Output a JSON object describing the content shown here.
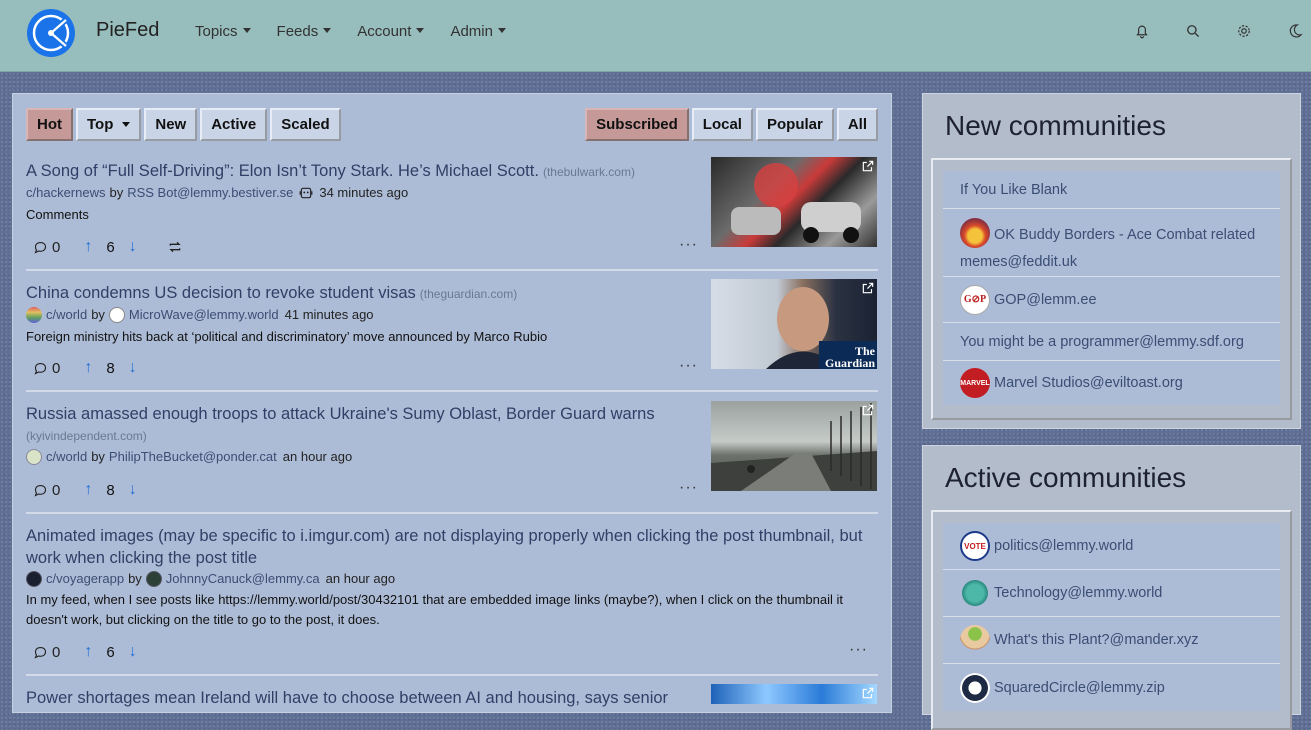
{
  "nav": {
    "brand": "PieFed",
    "menu": [
      "Topics",
      "Feeds",
      "Account",
      "Admin"
    ]
  },
  "sort": {
    "left": [
      "Hot",
      "Top",
      "New",
      "Active",
      "Scaled"
    ],
    "right": [
      "Subscribed",
      "Local",
      "Popular",
      "All"
    ]
  },
  "posts": [
    {
      "title": "A Song of “Full Self-Driving”: Elon Isn’t Tony Stark. He’s Michael Scott.",
      "domain": "thebulwark.com",
      "community": "c/hackernews",
      "by": "by",
      "user": "RSS Bot@lemmy.bestiver.se",
      "time": "34 minutes ago",
      "body": "Comments",
      "comments": "0",
      "score": "6"
    },
    {
      "title": "China condemns US decision to revoke student visas",
      "domain": "theguardian.com",
      "community": "c/world",
      "by": "by",
      "user": "MicroWave@lemmy.world",
      "time": "41 minutes ago",
      "body": "Foreign ministry hits back at ‘political and discriminatory’ move announced by Marco Rubio",
      "comments": "0",
      "score": "8",
      "thumb_text": "The Guardian"
    },
    {
      "title": "Russia amassed enough troops to attack Ukraine's Sumy Oblast, Border Guard warns",
      "domain": "kyivindependent.com",
      "community": "c/world",
      "by": "by",
      "user": "PhilipTheBucket@ponder.cat",
      "time": "an hour ago",
      "comments": "0",
      "score": "8"
    },
    {
      "title": "Animated images (may be specific to i.imgur.com) are not displaying properly when clicking the post thumbnail, but work when clicking the post title",
      "community": "c/voyagerapp",
      "by": "by",
      "user": "JohnnyCanuck@lemmy.ca",
      "time": "an hour ago",
      "body": "In my feed, when I see posts like https://lemmy.world/post/30432101 that are embedded image links (maybe?), when I click on the thumbnail it doesn't work, but clicking on the title to go to the post, it does.",
      "comments": "0",
      "score": "6"
    },
    {
      "title": "Power shortages mean Ireland will have to choose between AI and housing, says senior"
    }
  ],
  "new_communities": {
    "title": "New communities",
    "items": [
      "If You Like Blank",
      "OK Buddy Borders - Ace Combat related memes@feddit.uk",
      "GOP@lemm.ee",
      "You might be a programmer@lemmy.sdf.org",
      "Marvel Studios@eviltoast.org"
    ],
    "gop_logo_text": "G⊘P",
    "marvel_logo_text": "MARVEL"
  },
  "active_communities": {
    "title": "Active communities",
    "items": [
      "politics@lemmy.world",
      "Technology@lemmy.world",
      "What's this Plant?@mander.xyz",
      "SquaredCircle@lemmy.zip"
    ],
    "vote_logo_text": "VOTE"
  },
  "colors": {
    "navbar": "#98bdbd",
    "panel": "#adbcd6",
    "active_button": "#c69999",
    "link": "#2f3f66",
    "vote_arrow": "#1f6fd6"
  }
}
